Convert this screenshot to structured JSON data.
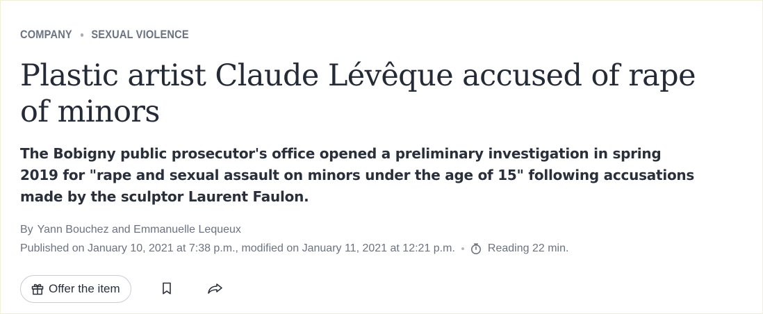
{
  "kicker": {
    "section": "Company",
    "topic": "Sexual violence"
  },
  "article": {
    "title": "Plastic artist Claude Lévêque accused of rape of minors",
    "standfirst": "The Bobigny public prosecutor's office opened a preliminary investigation in spring 2019 for \"rape and sexual assault on minors under the age of 15\" following accusations made by the sculptor Laurent Faulon.",
    "by_label": "By",
    "authors": "Yann Bouchez and Emmanuelle Lequeux",
    "published": "Published on January 10, 2021 at 7:38 p.m., modified on January 11, 2021 at 12:21 p.m.",
    "reading_time": "Reading 22 min."
  },
  "actions": {
    "offer_label": "Offer the item"
  },
  "icons": {
    "reading": "clock-icon",
    "offer": "gift-icon",
    "bookmark": "bookmark-icon",
    "share": "share-icon"
  },
  "colors": {
    "text": "#2a303b",
    "muted": "#6b7280",
    "border": "#c8ccd2"
  }
}
